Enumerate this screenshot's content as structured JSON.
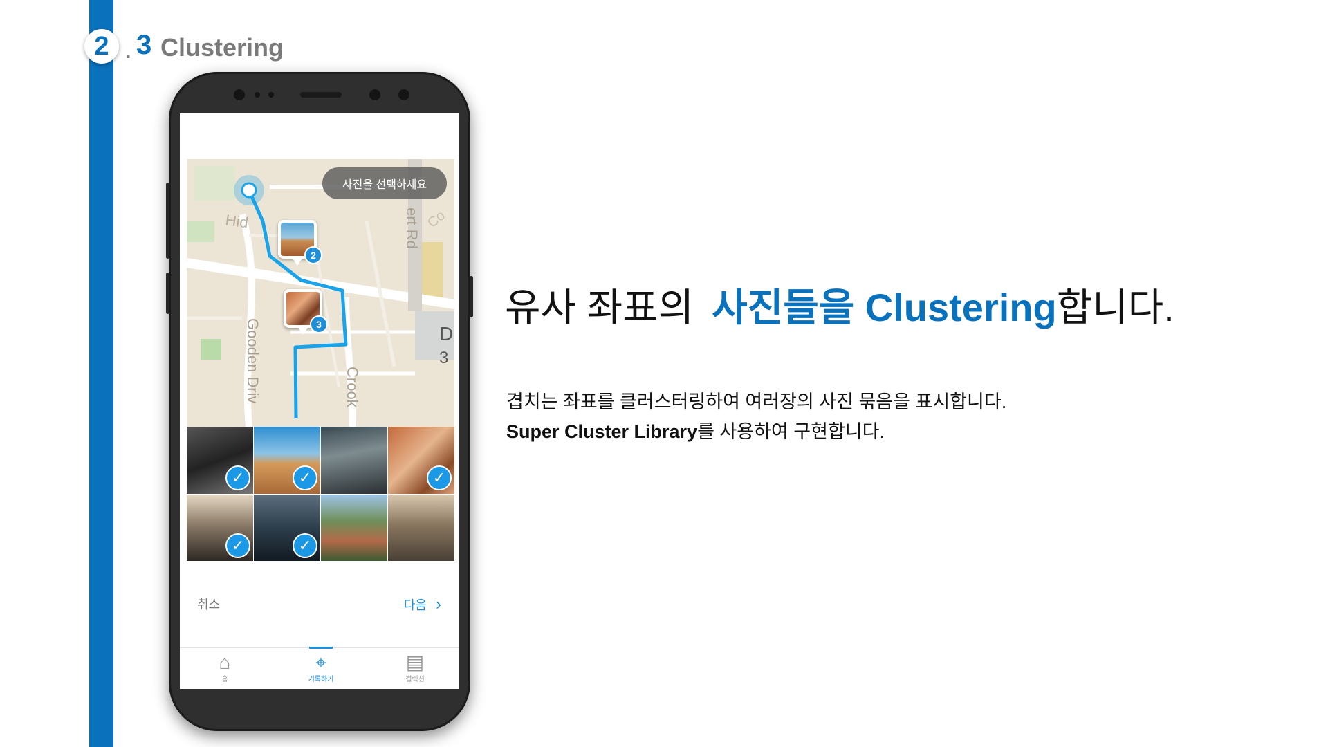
{
  "section": {
    "major": "2",
    "separator": ".",
    "minor": "3",
    "title": "Clustering"
  },
  "phone": {
    "map": {
      "toast": "사진을 선택하세요",
      "street_labels": [
        "Hid",
        "Gooden Driv",
        "Crook",
        "ert Rd",
        "Co",
        "D",
        "3"
      ],
      "clusters": [
        {
          "count": "2"
        },
        {
          "count": "3"
        }
      ]
    },
    "photo_grid": {
      "photos": [
        {
          "name": "photo-1",
          "selected": true
        },
        {
          "name": "photo-2",
          "selected": true
        },
        {
          "name": "photo-3",
          "selected": false
        },
        {
          "name": "photo-4",
          "selected": true
        },
        {
          "name": "photo-5",
          "selected": true
        },
        {
          "name": "photo-6",
          "selected": true
        },
        {
          "name": "photo-7",
          "selected": false
        },
        {
          "name": "photo-8",
          "selected": false
        }
      ],
      "check_glyph": "✓"
    },
    "actions": {
      "cancel": "취소",
      "next": "다음",
      "next_chevron": "›"
    },
    "tabbar": {
      "tabs": [
        {
          "label": "홈",
          "icon": "home-icon"
        },
        {
          "label": "기록하기",
          "icon": "map-pin-icon",
          "active": true
        },
        {
          "label": "컬렉션",
          "icon": "collection-icon"
        }
      ]
    }
  },
  "headline": {
    "prefix": "유사 좌표의",
    "highlight": "사진들을 Clustering",
    "suffix": "합니다."
  },
  "description": {
    "line1": "겹치는 좌표를 클러스터링하여 여러장의 사진 묶음을 표시합니다.",
    "line2_bold": "Super Cluster Library",
    "line2_rest": "를 사용하여 구현합니다."
  },
  "colors": {
    "accent": "#0a72bc",
    "app_blue": "#1e8fd8",
    "route": "#1aa3e8"
  }
}
